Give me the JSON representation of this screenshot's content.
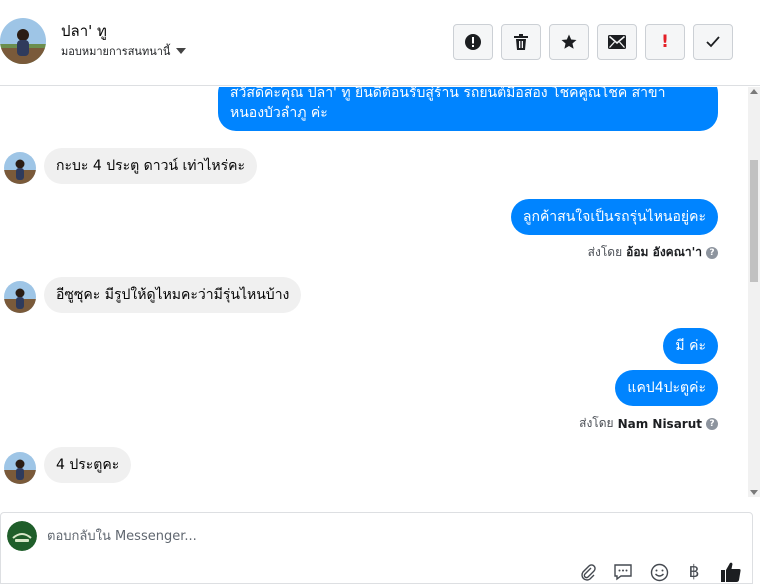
{
  "header": {
    "contact_name": "ปลา' ทู",
    "assign_label": "มอบหมายการสนทนานี้",
    "toolbar": {
      "spam_icon": "!",
      "flag_text": "!"
    }
  },
  "messages": [
    {
      "side": "out",
      "text_lines": [
        "สวัสดีค่ะคุณ ปลา' ทู ยินดีต้อนรับสู่ร้าน รถยนต์มือสอง โชคคูณโชค สาขา",
        "หนองบัวลำภู ค่ะ"
      ]
    },
    {
      "side": "in",
      "text": "กะบะ 4 ประตู ดาวน์ เท่าไหร่คะ"
    },
    {
      "side": "out",
      "text": "ลูกค้าสนใจเป็นรถรุ่นไหนอยู่คะ",
      "sent_by_prefix": "ส่งโดย",
      "sent_by_name": "อ้อม อังคณา'า"
    },
    {
      "side": "in",
      "text": "อีซูซุคะ มีรูปให้ดูไหมคะว่ามีรุ่นไหนบ้าง"
    },
    {
      "side": "out",
      "text": "มี ค่ะ"
    },
    {
      "side": "out",
      "text": "แคป4ปะตูค่ะ",
      "sent_by_prefix": "ส่งโดย",
      "sent_by_name": "Nam Nisarut"
    },
    {
      "side": "in",
      "text": "4 ประตูคะ"
    }
  ],
  "composer": {
    "placeholder": "ตอบกลับใน Messenger...",
    "currency_symbol": "฿"
  },
  "colors": {
    "outgoing": "#0084ff",
    "incoming": "#f0f0f0",
    "flag_red": "#e41e26"
  }
}
